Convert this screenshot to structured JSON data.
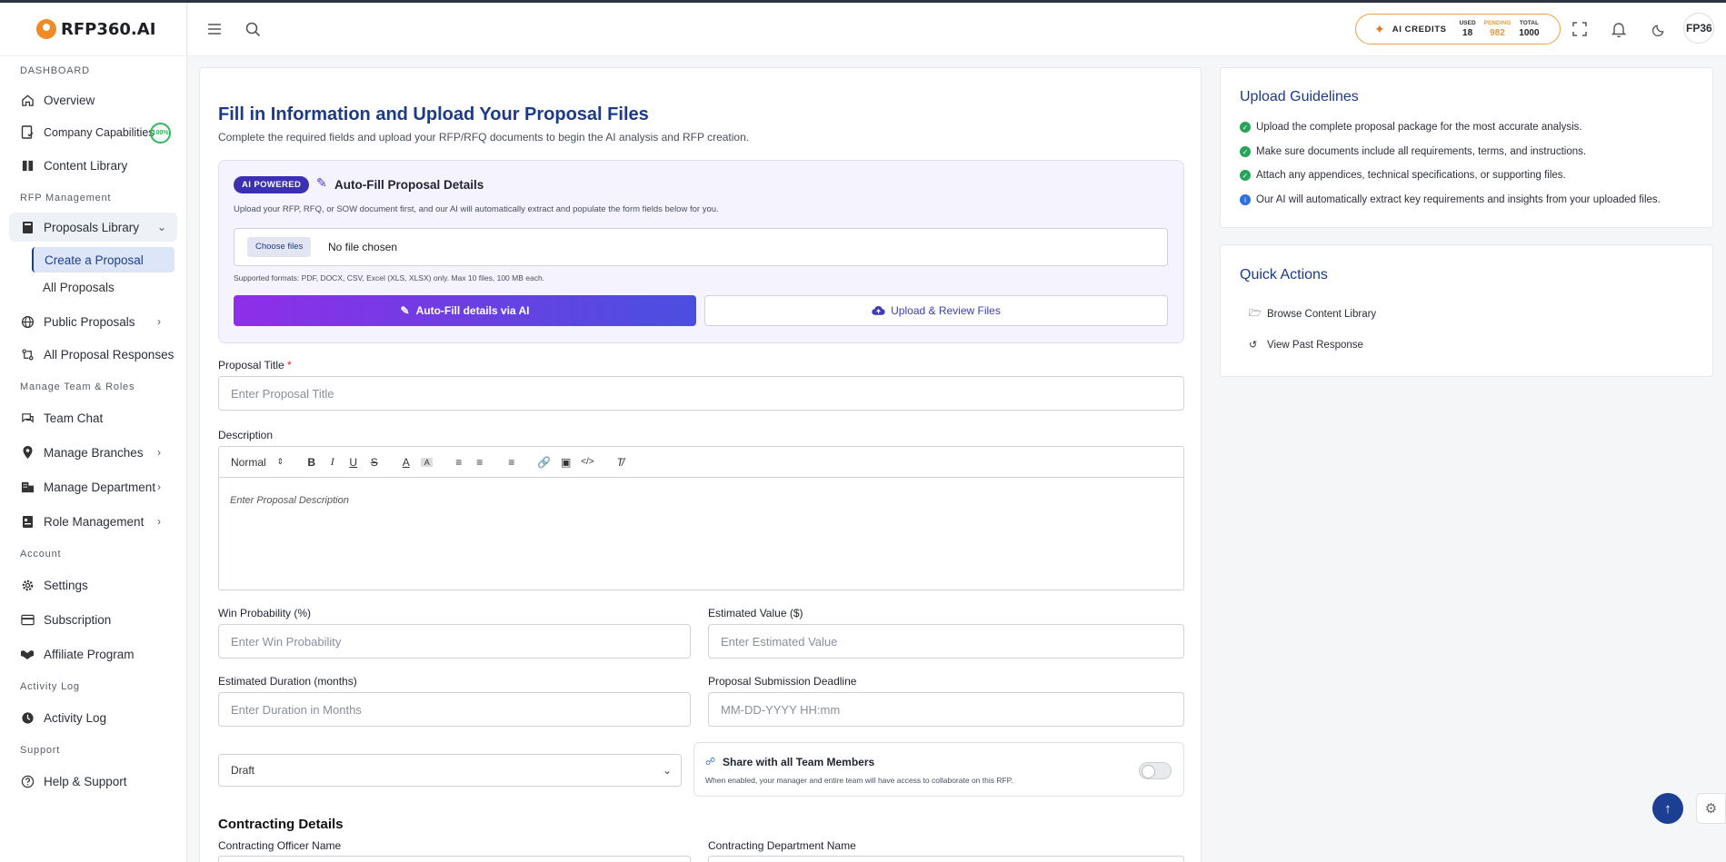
{
  "brand": {
    "name": "RFP360.AI"
  },
  "sidebar": {
    "sections": [
      "DASHBOARD",
      "RFP Management",
      "Manage Team & Roles",
      "Account",
      "Activity Log",
      "Support"
    ],
    "items": {
      "overview": "Overview",
      "company_capabilities": "Company Capabilities",
      "company_capabilities_badge": "100%",
      "content_library": "Content Library",
      "proposals_library": "Proposals Library",
      "create_proposal": "Create a Proposal",
      "all_proposals": "All Proposals",
      "public_proposals": "Public Proposals",
      "all_proposal_responses": "All Proposal Responses",
      "team_chat": "Team Chat",
      "manage_branches": "Manage Branches",
      "manage_department": "Manage Department",
      "role_management": "Role Management",
      "settings": "Settings",
      "subscription": "Subscription",
      "affiliate_program": "Affiliate Program",
      "activity_log": "Activity Log",
      "help_support": "Help & Support"
    }
  },
  "header": {
    "credits": {
      "label": "AI CREDITS",
      "used_label": "USED",
      "used": "18",
      "pending_label": "PENDING",
      "pending": "982",
      "total_label": "TOTAL",
      "total": "1000"
    },
    "avatar_text": "FP36"
  },
  "form": {
    "title": "Fill in Information and Upload Your Proposal Files",
    "subtitle": "Complete the required fields and upload your RFP/RFQ documents to begin the AI analysis and RFP creation.",
    "ai": {
      "pill": "AI POWERED",
      "title": "Auto-Fill Proposal Details",
      "desc": "Upload your RFP, RFQ, or SOW document first, and our AI will automatically extract and populate the form fields below for you.",
      "choose_files": "Choose files",
      "no_file": "No file chosen",
      "formats": "Supported formats: PDF, DOCX, CSV, Excel (XLS, XLSX) only. Max 10 files, 100 MB each.",
      "autofill_btn": "Auto-Fill details via AI",
      "upload_btn": "Upload & Review Files"
    },
    "proposal_title_label": "Proposal Title",
    "required_mark": "*",
    "proposal_title_ph": "Enter Proposal Title",
    "description_label": "Description",
    "editor_format": "Normal",
    "description_ph": "Enter Proposal Description",
    "win_prob_label": "Win Probability (%)",
    "win_prob_ph": "Enter Win Probability",
    "est_value_label": "Estimated Value ($)",
    "est_value_ph": "Enter Estimated Value",
    "duration_label": "Estimated Duration (months)",
    "duration_ph": "Enter Duration in Months",
    "deadline_label": "Proposal Submission Deadline",
    "deadline_ph": "MM-DD-YYYY HH:mm",
    "status_value": "Draft",
    "share_title": "Share with all Team Members",
    "share_desc": "When enabled, your manager and entire team will have access to collaborate on this RFP.",
    "contracting_heading": "Contracting Details",
    "officer_label": "Contracting Officer Name",
    "department_label": "Contracting Department Name"
  },
  "guidelines": {
    "title": "Upload Guidelines",
    "items": [
      "Upload the complete proposal package for the most accurate analysis.",
      "Make sure documents include all requirements, terms, and instructions.",
      "Attach any appendices, technical specifications, or supporting files.",
      "Our AI will automatically extract key requirements and insights from your uploaded files."
    ]
  },
  "quick_actions": {
    "title": "Quick Actions",
    "items": [
      "Browse Content Library",
      "View Past Response"
    ]
  }
}
